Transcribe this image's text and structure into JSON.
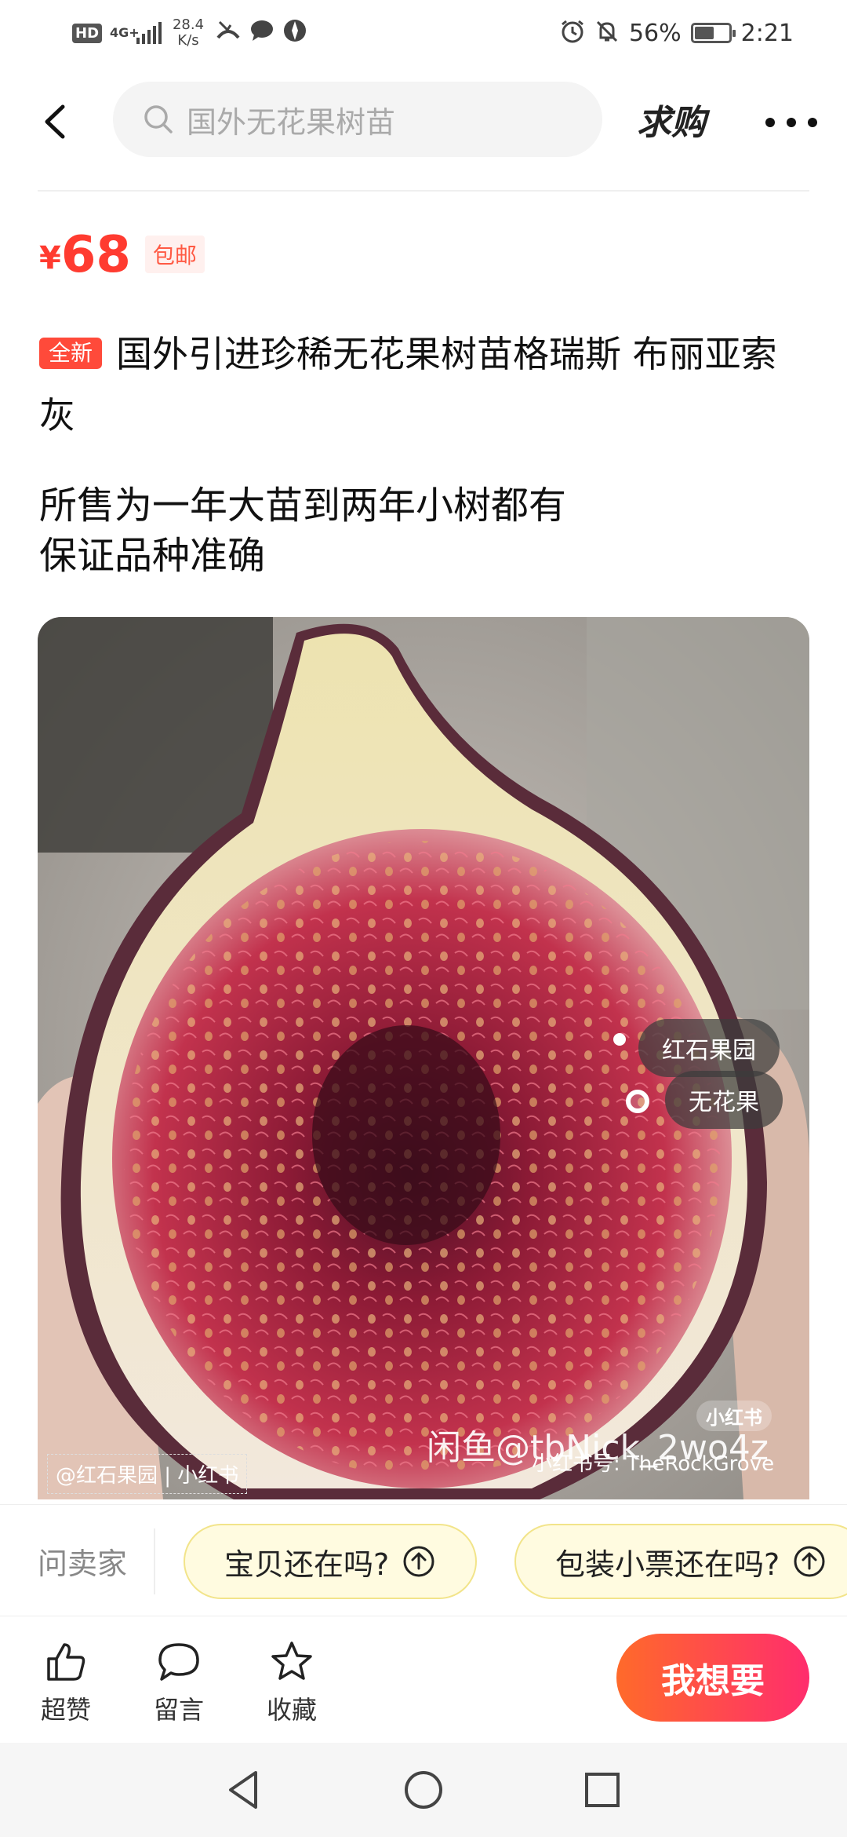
{
  "status_bar": {
    "hd": "HD",
    "network": "4G+",
    "speed_value": "28.4",
    "speed_unit": "K/s",
    "battery_percent": "56%",
    "battery_level": 0.56,
    "time": "2:21"
  },
  "header": {
    "search_placeholder": "国外无花果树苗",
    "buy_label": "求购"
  },
  "price": {
    "currency": "¥",
    "amount": "68",
    "shipping_badge": "包邮"
  },
  "product": {
    "condition_badge": "全新",
    "title": "国外引进珍稀无花果树苗格瑞斯 布丽亚索灰",
    "desc_line1": "所售为一年大苗到两年小树都有",
    "desc_line2": "保证品种准确"
  },
  "image": {
    "tag1": "红石果园",
    "tag2": "无花果",
    "watermark": "闲鱼@tbNick_2wo4z",
    "source_account": "@红石果园 | 小红书",
    "source_id": "小红书号: TheRockGrove",
    "logo": "小红书"
  },
  "ask": {
    "label": "问卖家",
    "chips": [
      "宝贝还在吗?",
      "包装小票还在吗?"
    ]
  },
  "actions": {
    "like": "超赞",
    "comment": "留言",
    "favorite": "收藏",
    "want": "我想要"
  },
  "colors": {
    "price": "#ff3b30",
    "accent_start": "#ff6a2a",
    "accent_end": "#ff2d6d",
    "chip_bg": "#fffbe0"
  }
}
